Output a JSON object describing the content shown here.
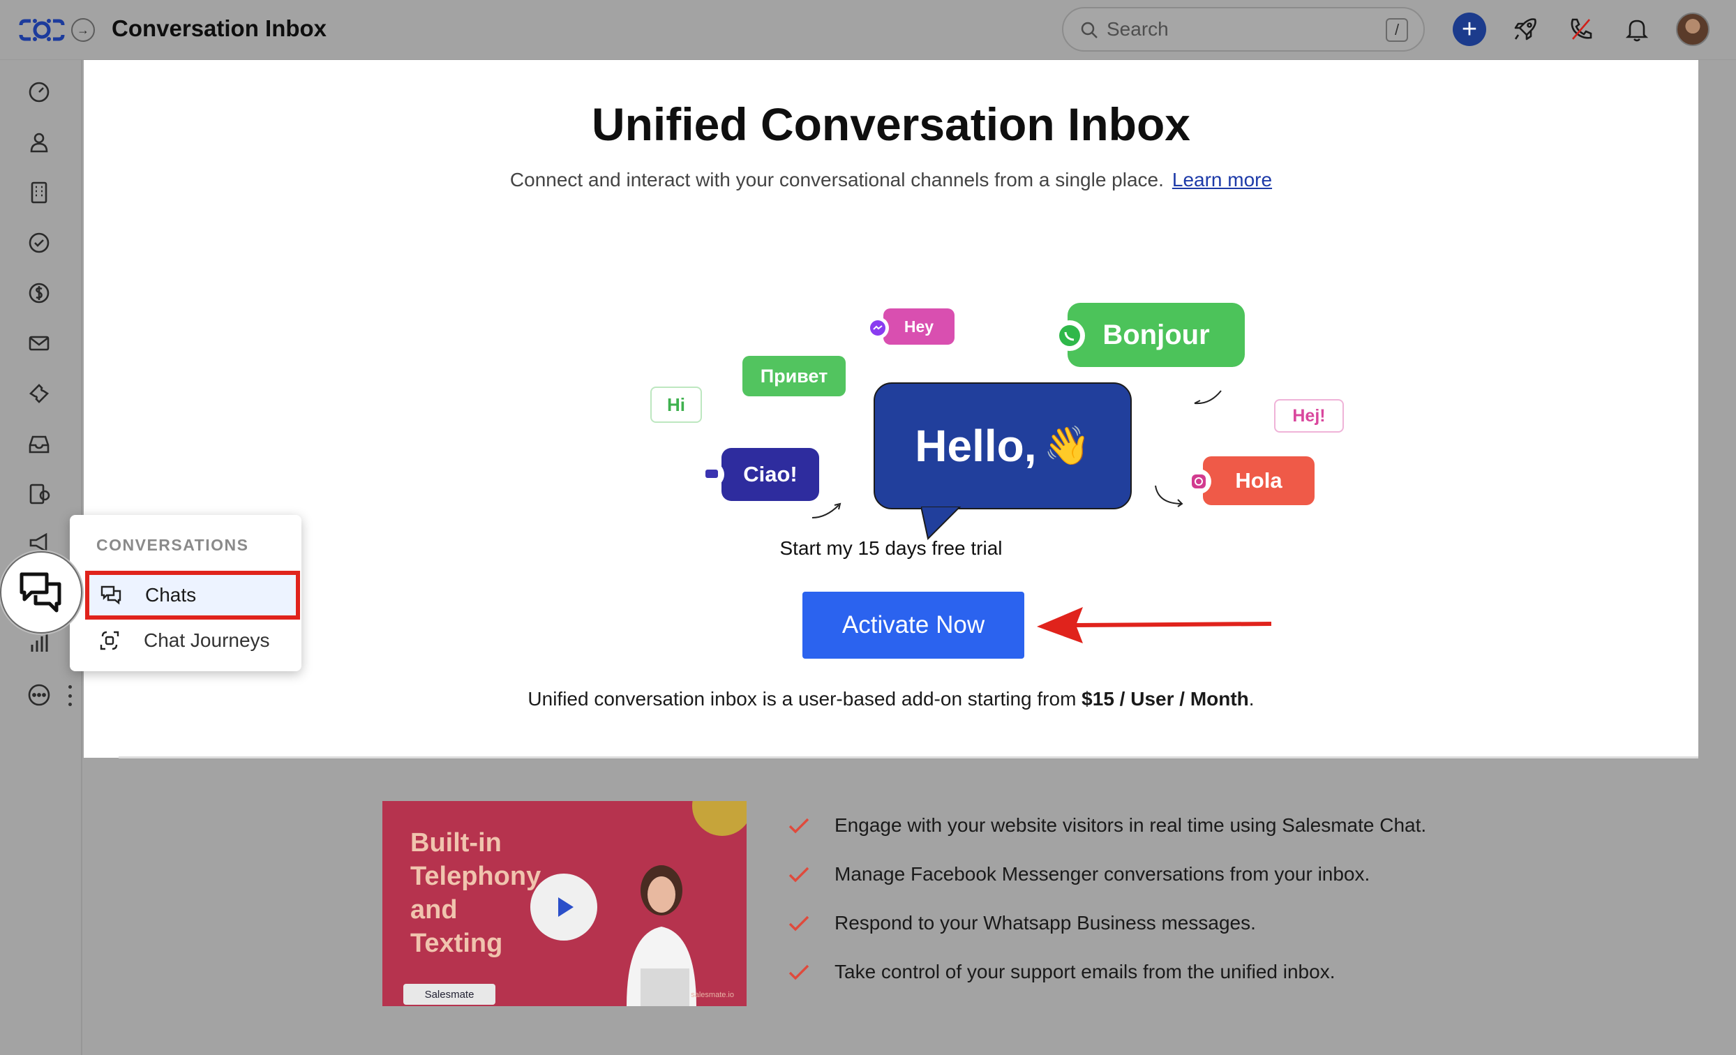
{
  "header": {
    "title": "Conversation Inbox",
    "search_placeholder": "Search",
    "search_shortcut": "/"
  },
  "menu": {
    "section_title": "CONVERSATIONS",
    "items": [
      {
        "label": "Chats",
        "active": true
      },
      {
        "label": "Chat Journeys",
        "active": false
      }
    ]
  },
  "hero": {
    "title": "Unified Conversation Inbox",
    "subtitle": "Connect and interact with your conversational channels from a single place.",
    "learn_more": "Learn more"
  },
  "illustration": {
    "bubbles": {
      "hey": "Hey",
      "bonjour": "Bonjour",
      "privet": "Привет",
      "hi": "Hi",
      "hello": "Hello,",
      "hej": "Hej!",
      "ciao": "Ciao!",
      "hola": "Hola"
    },
    "wave_emoji": "👋"
  },
  "cta": {
    "trial_text": "Start my 15 days free trial",
    "activate_label": "Activate Now",
    "pricing_prefix": "Unified conversation inbox is a user-based add-on starting from ",
    "pricing_amount": "$15 / User / Month",
    "pricing_suffix": "."
  },
  "video": {
    "title_line1": "Built-in",
    "title_line2": "Telephony",
    "title_line3": "and",
    "title_line4": "Texting",
    "brand": "Salesmate",
    "url": "salesmate.io"
  },
  "features": [
    "Engage with your website visitors in real time using Salesmate Chat.",
    "Manage Facebook Messenger conversations from your inbox.",
    "Respond to your Whatsapp Business messages.",
    "Take control of your support emails from the unified inbox."
  ],
  "colors": {
    "accent_blue": "#2b63ef",
    "highlight_red": "#e0231c",
    "hello_bubble": "#213f9c",
    "whatsapp_green": "#4cc35a",
    "hola_red": "#ef5a48",
    "hey_pink": "#d94fb0",
    "ciao_indigo": "#2e2c9e"
  }
}
